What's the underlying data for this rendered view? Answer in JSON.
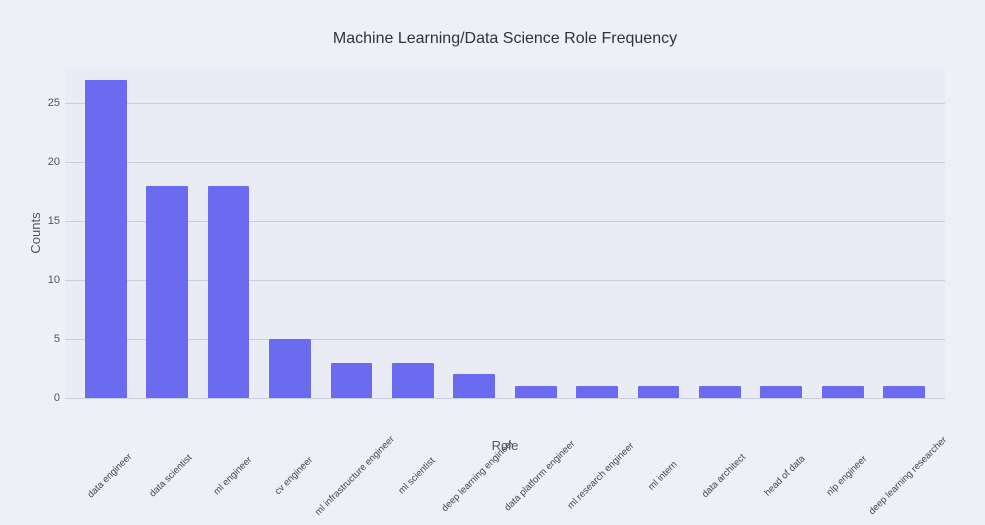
{
  "chart": {
    "title": "Machine Learning/Data Science Role Frequency",
    "x_axis_label": "Role",
    "y_axis_label": "Counts",
    "max_value": 28,
    "y_ticks": [
      0,
      5,
      10,
      15,
      20,
      25
    ],
    "bars": [
      {
        "label": "data engineer",
        "value": 27
      },
      {
        "label": "data scientist",
        "value": 18
      },
      {
        "label": "ml engineer",
        "value": 18
      },
      {
        "label": "cv engineer",
        "value": 5
      },
      {
        "label": "ml infrastructure engineer",
        "value": 3
      },
      {
        "label": "ml scientist",
        "value": 3
      },
      {
        "label": "deep learning engineer",
        "value": 2
      },
      {
        "label": "data platform engineer",
        "value": 1
      },
      {
        "label": "ml research engineer",
        "value": 1
      },
      {
        "label": "ml intern",
        "value": 1
      },
      {
        "label": "data architect",
        "value": 1
      },
      {
        "label": "head of data",
        "value": 1
      },
      {
        "label": "nlp engineer",
        "value": 1
      },
      {
        "label": "deep learning researcher",
        "value": 1
      }
    ],
    "colors": {
      "bar_fill": "#6b6bef",
      "background": "#eaecf5",
      "gridline": "#c8ccdf"
    }
  }
}
